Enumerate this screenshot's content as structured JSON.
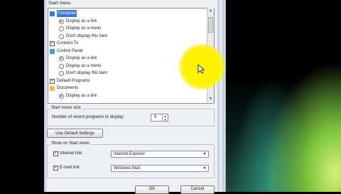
{
  "dialog": {
    "start_menu_label": "Start menu",
    "items": [
      {
        "kind": "folder",
        "icon": "computer-icon",
        "label": "Computer",
        "selected": true
      },
      {
        "kind": "radio",
        "label": "Display as a link",
        "checked": true
      },
      {
        "kind": "radio",
        "label": "Display as a menu",
        "checked": false
      },
      {
        "kind": "radio",
        "label": "Don't display this item",
        "checked": false
      },
      {
        "kind": "check",
        "label": "Connect To",
        "checked": true
      },
      {
        "kind": "folder",
        "icon": "control-panel-icon",
        "label": "Control Panel",
        "selected": false
      },
      {
        "kind": "radio",
        "label": "Display as a link",
        "checked": true
      },
      {
        "kind": "radio",
        "label": "Display as a menu",
        "checked": false
      },
      {
        "kind": "radio",
        "label": "Don't display this item",
        "checked": false
      },
      {
        "kind": "check",
        "label": "Default Programs",
        "checked": true
      },
      {
        "kind": "folder",
        "icon": "documents-icon",
        "label": "Documents",
        "selected": false
      },
      {
        "kind": "radio",
        "label": "Display as a link",
        "checked": true
      }
    ],
    "size_group_label": "Start menu size",
    "recent_programs_label": "Number of recent programs to display:",
    "recent_programs_value": "9",
    "default_settings_button": "Use Default Settings",
    "show_group_label": "Show on Start menu",
    "internet_link_label": "Internet link:",
    "internet_link_checked": true,
    "internet_link_value": "Internet Explorer",
    "email_link_label": "E-mail link:",
    "email_link_checked": true,
    "email_link_value": "Windows Mail",
    "ok_button": "OK",
    "cancel_button": "Cancel"
  },
  "colors": {
    "selection": "#3a78d6",
    "highlight": "#fff200"
  }
}
